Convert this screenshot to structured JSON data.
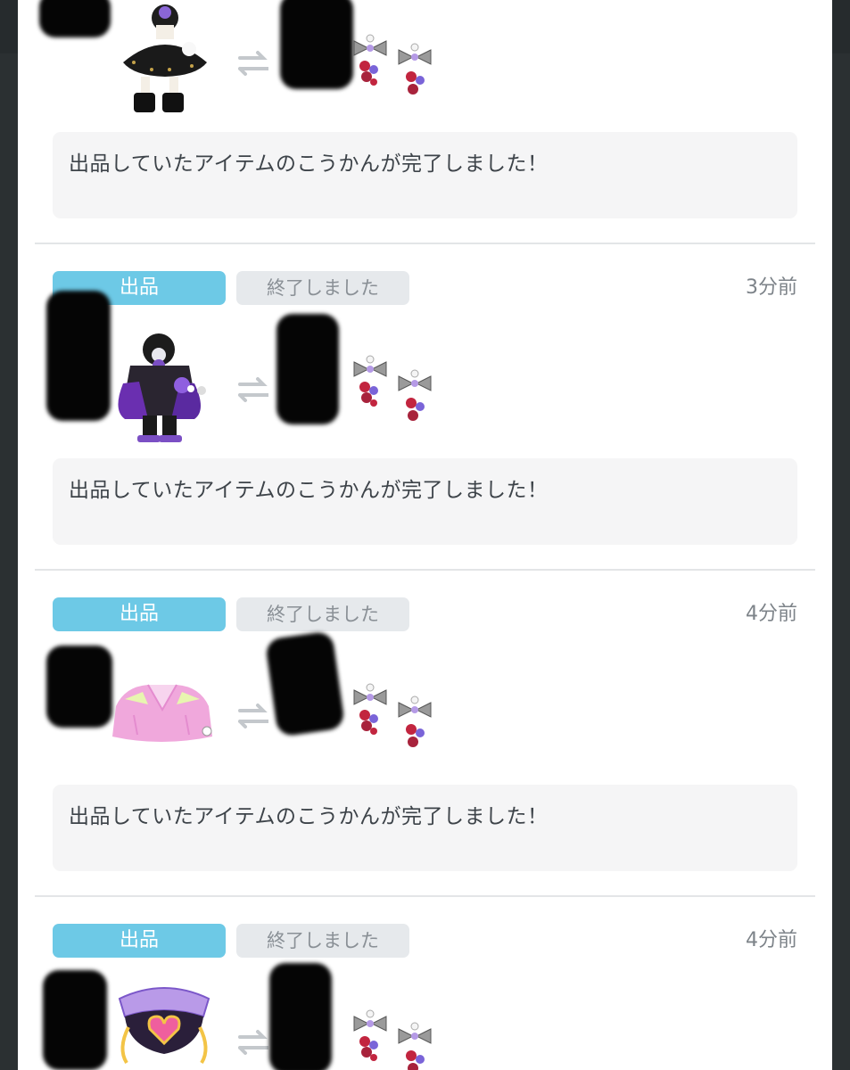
{
  "feed": {
    "items": [
      {
        "status_tag": "",
        "ended_tag": "",
        "time": "",
        "message": "出品していたアイテムのこうかんが完了しました！",
        "item_icon": "gothic-dress-avatar",
        "exchange_icon": "exchange-arrows-icon",
        "reward_icon": "ribbon-flower-charm"
      },
      {
        "status_tag": "出品",
        "ended_tag": "終了しました",
        "time": "3分前",
        "message": "出品していたアイテムのこうかんが完了しました！",
        "item_icon": "purple-rose-outfit-avatar",
        "exchange_icon": "exchange-arrows-icon",
        "reward_icon": "ribbon-flower-charm"
      },
      {
        "status_tag": "出品",
        "ended_tag": "終了しました",
        "time": "4分前",
        "message": "出品していたアイテムのこうかんが完了しました！",
        "item_icon": "pink-jacket-item",
        "exchange_icon": "exchange-arrows-icon",
        "reward_icon": "ribbon-flower-charm"
      },
      {
        "status_tag": "出品",
        "ended_tag": "終了しました",
        "time": "4分前",
        "message": "",
        "item_icon": "purple-heart-hat-item",
        "exchange_icon": "exchange-arrows-icon",
        "reward_icon": "ribbon-flower-charm"
      }
    ]
  },
  "colors": {
    "listing_tag": "#6dc9e6",
    "ended_tag": "#e6e9ec",
    "message_box": "#f5f5f6",
    "background": "#2b3032"
  }
}
